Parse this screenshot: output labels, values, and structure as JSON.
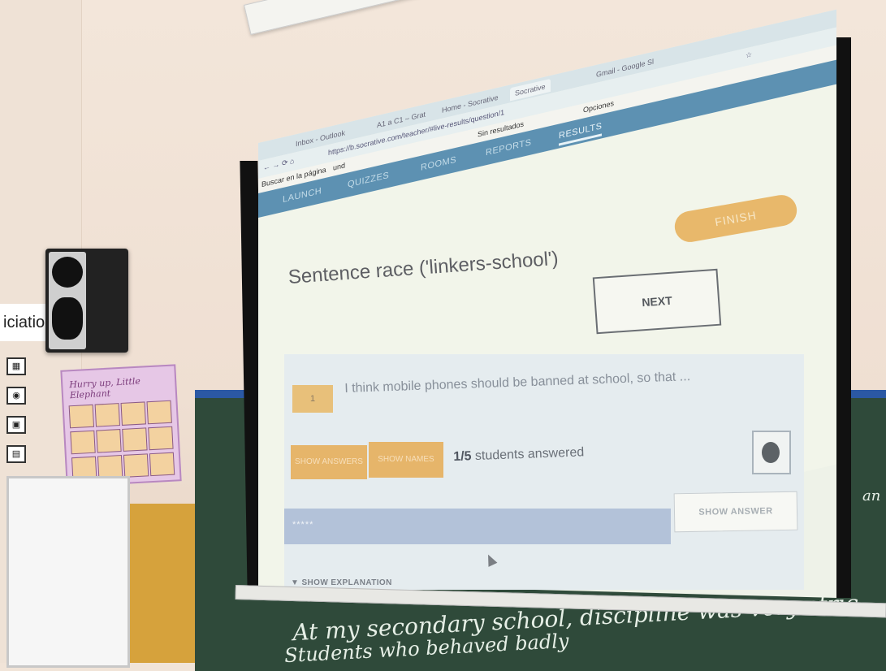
{
  "browser": {
    "tabs": [
      "Inbox - Outlook",
      "A1 a C1 – Grat",
      "Home - Socrative",
      "Socrative",
      "Gmail - Google Sl"
    ],
    "url": "https://b.socrative.com/teacher/#live-results/question/1",
    "find_label": "Buscar en la página",
    "find_value": "und",
    "find_status": "Sin resultados",
    "find_options": "Opciones"
  },
  "topnav": {
    "items": [
      "LAUNCH",
      "QUIZZES",
      "ROOMS",
      "REPORTS",
      "RESULTS"
    ],
    "active": "RESULTS",
    "finish_label": "FINISH"
  },
  "quiz": {
    "title": "Sentence race ('linkers-school')",
    "next_label": "NEXT",
    "question_number": "1",
    "question_text": "I think mobile phones should be banned at school, so that ...",
    "show_answers_label": "SHOW ANSWERS",
    "show_names_label": "SHOW NAMES",
    "answered_count": "1/5",
    "answered_suffix": "students answered",
    "answer_masked": "*****",
    "show_answer_label": "SHOW ANSWER",
    "show_explanation_label": "▼ SHOW EXPLANATION"
  },
  "room": {
    "sign_text": "iciation",
    "poster_title": "Hurry up, Little Elephant",
    "chalk_line1": "At my secondary school, discipline was very stric",
    "chalk_line2": "Students who behaved badly",
    "chalk_edge": "an"
  },
  "colors": {
    "accent_blue": "#5d91b2",
    "finish_orange": "#e8b86b",
    "chalkboard_green": "#2f4a3a"
  }
}
